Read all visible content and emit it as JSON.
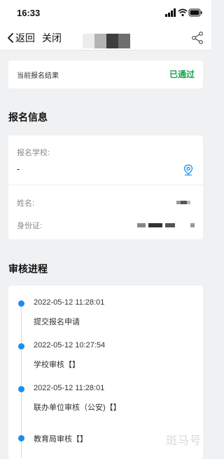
{
  "status_bar": {
    "time": "16:33",
    "icons": [
      "signal-icon",
      "wifi-icon",
      "battery-icon"
    ]
  },
  "nav": {
    "back_label": "返回",
    "close_label": "关闭",
    "share_icon": "share-icon"
  },
  "result": {
    "label": "当前报名结果",
    "status": "已通过",
    "status_color": "#1aa34a"
  },
  "info": {
    "section_title": "报名信息",
    "school_label": "报名学校:",
    "school_value": "-",
    "location_icon": "location-pin-icon",
    "name_label": "姓名:",
    "id_label": "身份证:"
  },
  "progress": {
    "section_title": "审核进程",
    "accent_color": "#1f8bf0",
    "items": [
      {
        "time": "2022-05-12 11:28:01",
        "step": "提交报名申请"
      },
      {
        "time": "2022-05-12 10:27:54",
        "step": "学校审核【】"
      },
      {
        "time": "2022-05-12 11:28:01",
        "step": "联办单位审核（公安)【】"
      },
      {
        "time": "",
        "step": "教育局审核【】"
      }
    ]
  },
  "watermark": "斑马号"
}
